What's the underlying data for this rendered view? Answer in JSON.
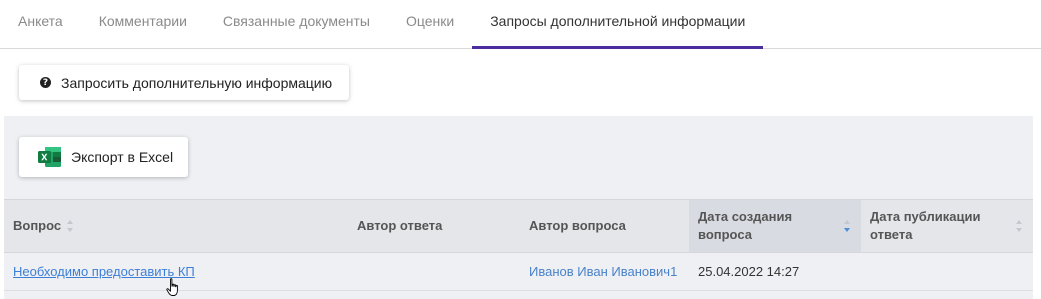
{
  "tabs": [
    {
      "label": "Анкета",
      "active": false
    },
    {
      "label": "Комментарии",
      "active": false
    },
    {
      "label": "Связанные документы",
      "active": false
    },
    {
      "label": "Оценки",
      "active": false
    },
    {
      "label": "Запросы дополнительной информации",
      "active": true
    }
  ],
  "request_button": {
    "label": "Запросить дополнительную информацию",
    "icon": "question-circle-icon"
  },
  "export_button": {
    "label": "Экспорт в Excel",
    "icon": "excel-icon"
  },
  "table": {
    "columns": [
      {
        "label": "Вопрос",
        "sortable": true,
        "sort": "none"
      },
      {
        "label": "Автор ответа",
        "sortable": false
      },
      {
        "label": "Автор вопроса",
        "sortable": false
      },
      {
        "label": "Дата создания вопроса",
        "sortable": true,
        "sort": "desc"
      },
      {
        "label": "Дата публикации ответа",
        "sortable": true,
        "sort": "none"
      }
    ],
    "rows": [
      {
        "question": "Необходимо предоставить КП",
        "answer_author": "",
        "question_author": "Иванов Иван Иванович1",
        "created": "25.04.2022 14:27",
        "published": ""
      }
    ]
  },
  "colors": {
    "accent": "#4b2d9f",
    "link": "#3d7fd6",
    "panel_bg": "#eef0f4",
    "excel_green": "#1d7044"
  }
}
